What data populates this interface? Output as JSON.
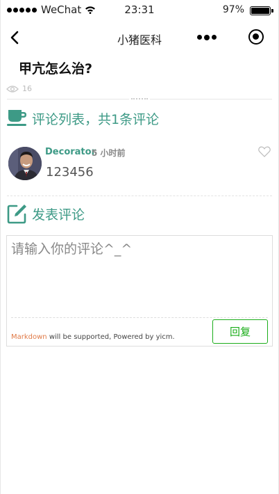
{
  "status_bar": {
    "carrier": "WeChat",
    "time": "23:31",
    "battery": "97%",
    "battery_level": 0.97
  },
  "nav": {
    "title": "小猪医科"
  },
  "question": {
    "title": "甲亢怎么治?",
    "views": "16"
  },
  "comments_section": {
    "heading": "评论列表，共1条评论",
    "items": [
      {
        "user": "Decorator",
        "time": "5 小时前",
        "text": "123456"
      }
    ]
  },
  "post_section": {
    "heading": "发表评论",
    "placeholder": "请输入你的评论^_^",
    "markdown_link": "Markdown",
    "note": " will be supported, Powered by yicm.",
    "reply_label": "回复"
  },
  "colors": {
    "accent": "#3d9a86",
    "button": "#1aad19",
    "markdown": "#e07a47"
  }
}
